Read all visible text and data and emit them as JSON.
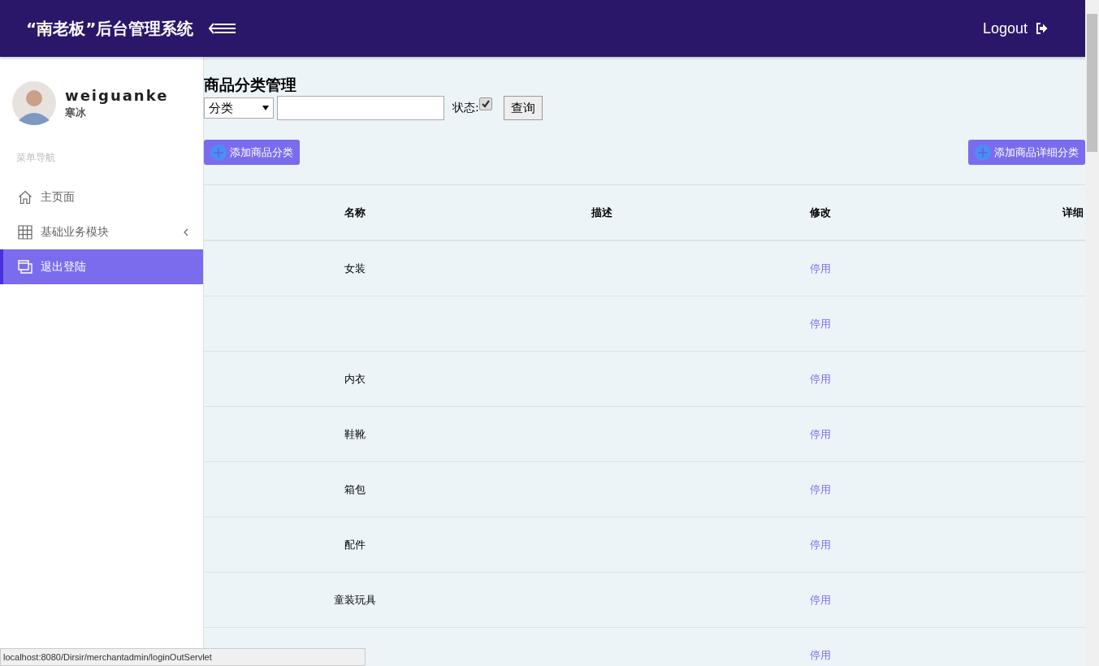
{
  "header": {
    "title": "“南老板”后台管理系统",
    "logout": "Logout"
  },
  "user": {
    "name": "weiguanke",
    "role": "寒冰"
  },
  "sidebar": {
    "heading": "菜单导航",
    "items": [
      {
        "label": "主页面",
        "kind": "link",
        "selected": false
      },
      {
        "label": "基础业务模块",
        "kind": "submenu",
        "selected": false
      },
      {
        "label": "退出登陆",
        "kind": "link",
        "selected": true
      }
    ]
  },
  "page": {
    "title": "商品分类管理",
    "filter": {
      "select": "分类",
      "status_label": "状态:",
      "status_checked": true,
      "query": "查询"
    },
    "add_button": "添加商品分类",
    "add_detail_button": "添加商品详细分类"
  },
  "table": {
    "columns": [
      "名称",
      "描述",
      "修改",
      "详细"
    ],
    "rows": [
      {
        "name": "女装",
        "action": "停用"
      },
      {
        "action": "停用"
      },
      {
        "name": "内衣",
        "action": "停用"
      },
      {
        "name": "鞋靴",
        "action": "停用"
      },
      {
        "name": "箱包",
        "action": "停用"
      },
      {
        "name": "配件",
        "action": "停用"
      },
      {
        "name": "童装玩具",
        "action": "停用"
      },
      {
        "action": "停用"
      }
    ]
  },
  "status_bar": "localhost:8080/Dirsir/merchantadmin/loginOutServlet"
}
